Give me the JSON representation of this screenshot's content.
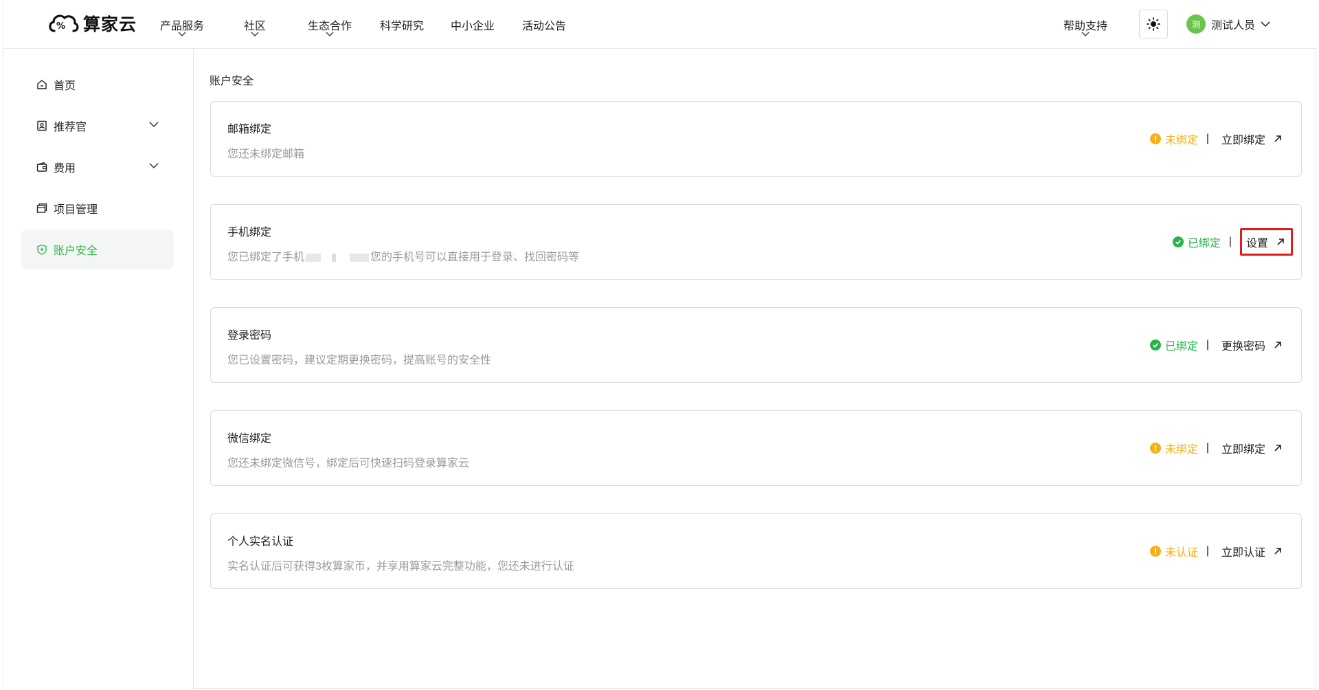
{
  "header": {
    "logo_text": "算家云",
    "nav": [
      {
        "label": "产品服务",
        "has_dropdown": true
      },
      {
        "label": "社区",
        "has_dropdown": true
      },
      {
        "label": "生态合作",
        "has_dropdown": true
      },
      {
        "label": "科学研究",
        "has_dropdown": false
      },
      {
        "label": "中小企业",
        "has_dropdown": false
      },
      {
        "label": "活动公告",
        "has_dropdown": false
      }
    ],
    "help_label": "帮助支持",
    "theme_icon": "sun-icon",
    "user": {
      "avatar_text": "测",
      "name": "测试人员",
      "avatar_color": "#6cc54a"
    }
  },
  "sidebar": {
    "items": [
      {
        "label": "首页",
        "icon": "home-icon",
        "has_dropdown": false
      },
      {
        "label": "推荐官",
        "icon": "referral-icon",
        "has_dropdown": true
      },
      {
        "label": "费用",
        "icon": "wallet-icon",
        "has_dropdown": true
      },
      {
        "label": "项目管理",
        "icon": "project-icon",
        "has_dropdown": false
      },
      {
        "label": "账户安全",
        "icon": "shield-icon",
        "has_dropdown": false,
        "active": true
      }
    ]
  },
  "main": {
    "breadcrumb": "账户安全",
    "cards": [
      {
        "title": "邮箱绑定",
        "desc": "您还未绑定邮箱",
        "status": "未绑定",
        "status_type": "warning",
        "action": "立即绑定"
      },
      {
        "title": "手机绑定",
        "desc_prefix": "您已绑定了手机",
        "desc_suffix": "您的手机号可以直接用于登录、找回密码等",
        "status": "已绑定",
        "status_type": "success",
        "action": "设置",
        "highlighted": true
      },
      {
        "title": "登录密码",
        "desc": "您已设置密码，建议定期更换密码，提高账号的安全性",
        "status": "已绑定",
        "status_type": "success",
        "action": "更换密码"
      },
      {
        "title": "微信绑定",
        "desc": "您还未绑定微信号，绑定后可快速扫码登录算家云",
        "status": "未绑定",
        "status_type": "warning",
        "action": "立即绑定"
      },
      {
        "title": "个人实名认证",
        "desc": "实名认证后可获得3枚算家币，并享用算家云完整功能，您还未进行认证",
        "status": "未认证",
        "status_type": "warning",
        "action": "立即认证"
      }
    ],
    "separator": "|"
  },
  "colors": {
    "accent_green": "#2fb84a",
    "warning": "#f5b01a",
    "success": "#27b34a",
    "highlight_border": "#e11a1a"
  }
}
